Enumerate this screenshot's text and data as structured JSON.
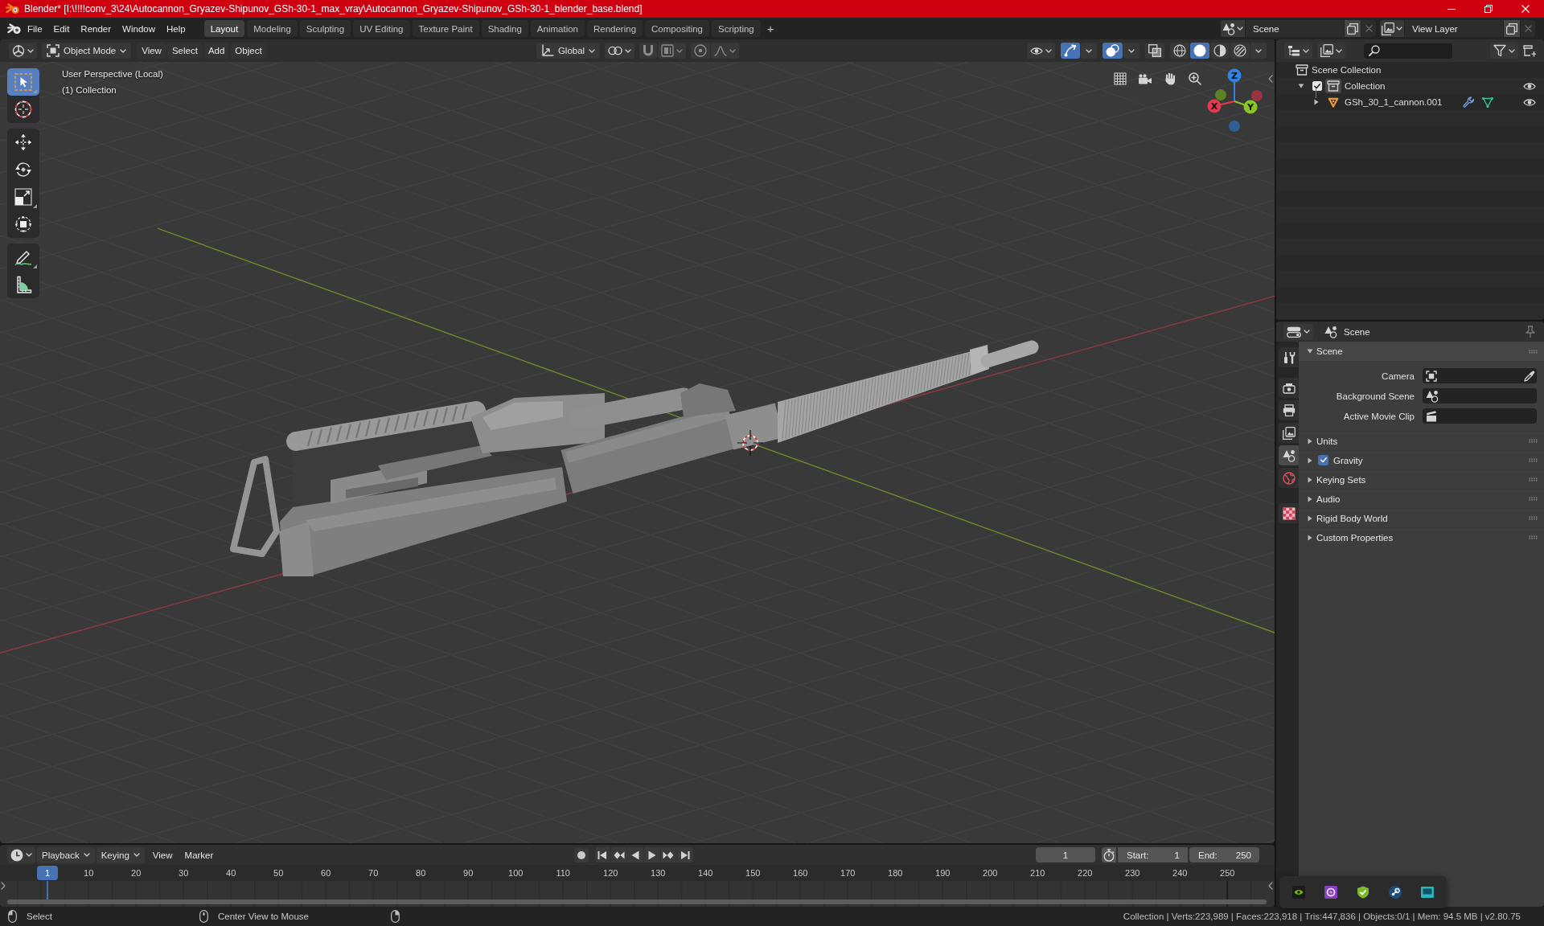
{
  "title_bar": {
    "title": "Blender* [I:\\!!!!conv_3\\24\\Autocannon_Gryazev-Shipunov_GSh-30-1_max_vray\\Autocannon_Gryazev-Shipunov_GSh-30-1_blender_base.blend]"
  },
  "top_bar": {
    "menus": [
      "File",
      "Edit",
      "Render",
      "Window",
      "Help"
    ],
    "workspaces": [
      {
        "label": "Layout",
        "selected": true
      },
      {
        "label": "Modeling",
        "selected": false
      },
      {
        "label": "Sculpting",
        "selected": false
      },
      {
        "label": "UV Editing",
        "selected": false
      },
      {
        "label": "Texture Paint",
        "selected": false
      },
      {
        "label": "Shading",
        "selected": false
      },
      {
        "label": "Animation",
        "selected": false
      },
      {
        "label": "Rendering",
        "selected": false
      },
      {
        "label": "Compositing",
        "selected": false
      },
      {
        "label": "Scripting",
        "selected": false
      }
    ],
    "add_workspace": "+",
    "scene": "Scene",
    "view_layer": "View Layer"
  },
  "viewport": {
    "header": {
      "mode": "Object Mode",
      "menus": [
        "View",
        "Select",
        "Add",
        "Object"
      ],
      "orientation": "Global",
      "snap": false,
      "proportional_editing": false,
      "gizmos": true,
      "overlays": true,
      "xray": false,
      "shading": [
        {
          "kind": "wireframe",
          "selected": false
        },
        {
          "kind": "solid",
          "selected": true
        },
        {
          "kind": "material",
          "selected": false
        },
        {
          "kind": "rendered",
          "selected": false
        }
      ]
    },
    "tool_groups": [
      [
        {
          "kind": "select-box",
          "selected": true,
          "has_variants": true
        },
        {
          "kind": "cursor",
          "selected": false,
          "has_variants": false
        }
      ],
      [
        {
          "kind": "move",
          "selected": false,
          "has_variants": false
        },
        {
          "kind": "rotate",
          "selected": false,
          "has_variants": false
        },
        {
          "kind": "scale",
          "selected": false,
          "has_variants": true
        },
        {
          "kind": "transform",
          "selected": false,
          "has_variants": false
        }
      ],
      [
        {
          "kind": "annotate",
          "selected": false,
          "has_variants": true
        },
        {
          "kind": "measure",
          "selected": false,
          "has_variants": false
        }
      ]
    ],
    "info": [
      "User Perspective (Local)",
      "(1) Collection"
    ],
    "gizmo_axes": [
      "Z",
      "X",
      "Y"
    ]
  },
  "outliner": {
    "tree": [
      {
        "label": "Scene Collection",
        "kind": "scene-collection",
        "active": false,
        "children": [
          {
            "label": "Collection",
            "kind": "collection",
            "active": true,
            "expanded": true,
            "checked": true,
            "visible": true,
            "children": [
              {
                "label": "GSh_30_1_cannon.001",
                "kind": "mesh",
                "active": false,
                "expanded": false,
                "visible": true,
                "contents": [
                  {
                    "kind": "modifier"
                  },
                  {
                    "kind": "mesh-data"
                  }
                ]
              }
            ]
          }
        ]
      }
    ]
  },
  "properties": {
    "context": "Scene",
    "pinned": false,
    "tab_groups": [
      [
        {
          "kind": "tool",
          "selected": false
        }
      ],
      [
        {
          "kind": "render",
          "selected": false
        },
        {
          "kind": "output",
          "selected": false
        },
        {
          "kind": "view-layer",
          "selected": false
        },
        {
          "kind": "scene",
          "selected": true
        },
        {
          "kind": "world",
          "selected": false
        }
      ],
      [
        {
          "kind": "texture",
          "selected": false
        }
      ]
    ],
    "panel": {
      "title": "Scene",
      "expanded": true,
      "fields": [
        {
          "label": "Camera",
          "kind": "camera",
          "eyedropper": true
        },
        {
          "label": "Background Scene",
          "kind": "scene",
          "eyedropper": false
        },
        {
          "label": "Active Movie Clip",
          "kind": "clip",
          "eyedropper": false
        }
      ]
    },
    "subpanels": [
      {
        "label": "Units",
        "kind": "plain",
        "expanded": false
      },
      {
        "label": "Gravity",
        "kind": "toggle",
        "checked": true,
        "expanded": false
      },
      {
        "label": "Keying Sets",
        "kind": "plain",
        "expanded": false
      },
      {
        "label": "Audio",
        "kind": "plain",
        "expanded": false
      },
      {
        "label": "Rigid Body World",
        "kind": "plain",
        "expanded": false
      },
      {
        "label": "Custom Properties",
        "kind": "plain",
        "expanded": false
      }
    ]
  },
  "timeline": {
    "menus": [
      {
        "label": "Playback",
        "dropdown": true
      },
      {
        "label": "Keying",
        "dropdown": true
      },
      {
        "label": "View",
        "dropdown": false
      },
      {
        "label": "Marker",
        "dropdown": false
      }
    ],
    "auto_keying": false,
    "transport": [
      {
        "kind": "jump-start"
      },
      {
        "kind": "prev-keyframe"
      },
      {
        "kind": "play-reverse"
      },
      {
        "kind": "play"
      },
      {
        "kind": "next-keyframe"
      },
      {
        "kind": "jump-end"
      }
    ],
    "current_frame": "1",
    "start_label": "Start:",
    "start": "1",
    "end_label": "End:",
    "end": "250",
    "playhead": "1",
    "ruler": [
      "10",
      "20",
      "30",
      "40",
      "50",
      "60",
      "70",
      "80",
      "90",
      "100",
      "110",
      "120",
      "130",
      "140",
      "150",
      "160",
      "170",
      "180",
      "190",
      "200",
      "210",
      "220",
      "230",
      "240",
      "250"
    ]
  },
  "status_bar": {
    "hints": [
      {
        "kind": "left",
        "label": "Select"
      },
      {
        "kind": "middle",
        "label": "Center View to Mouse"
      },
      {
        "kind": "right"
      }
    ],
    "stats": "Collection | Verts:223,989 | Faces:223,918 | Tris:447,836 | Objects:0/1 | Mem: 94.5 MB | v2.80.75"
  },
  "tray": {
    "icons": [
      {
        "kind": "chip"
      },
      {
        "kind": "ring"
      },
      {
        "kind": "shield"
      },
      {
        "kind": "disc"
      },
      {
        "kind": "monitor"
      }
    ]
  }
}
